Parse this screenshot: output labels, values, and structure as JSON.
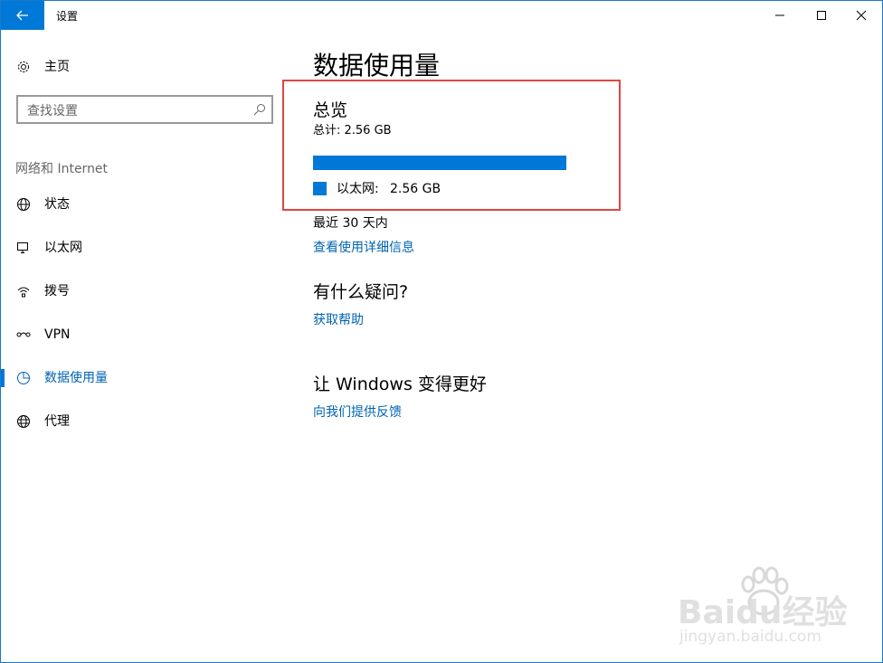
{
  "window": {
    "title": "设置"
  },
  "sidebar": {
    "home_label": "主页",
    "search_placeholder": "查找设置",
    "section_label": "网络和 Internet",
    "items": [
      {
        "label": "状态",
        "icon": "globe-status-icon"
      },
      {
        "label": "以太网",
        "icon": "ethernet-icon"
      },
      {
        "label": "拨号",
        "icon": "dialup-icon"
      },
      {
        "label": "VPN",
        "icon": "vpn-icon"
      },
      {
        "label": "数据使用量",
        "icon": "pie-chart-icon",
        "active": true
      },
      {
        "label": "代理",
        "icon": "globe-icon"
      }
    ]
  },
  "main": {
    "page_title": "数据使用量",
    "overview": {
      "title": "总览",
      "total": "总计: 2.56 GB",
      "usage_fraction": 1.0,
      "legend_label": "以太网:",
      "legend_value": "2.56 GB"
    },
    "recent": "最近 30 天内",
    "details_link": "查看使用详细信息",
    "question_title": "有什么疑问?",
    "help_link": "获取帮助",
    "improve_title": "让 Windows 变得更好",
    "feedback_link": "向我们提供反馈"
  },
  "watermark": {
    "brand": "Baidu经验",
    "url": "jingyan.baidu.com"
  },
  "colors": {
    "accent": "#0078d7",
    "link": "#0063b1",
    "highlight": "#e04545"
  }
}
